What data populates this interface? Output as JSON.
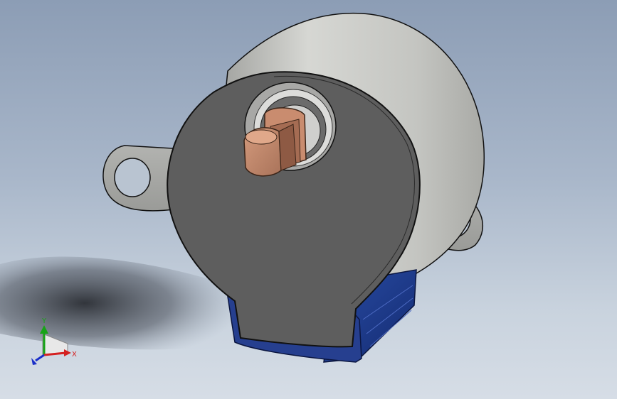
{
  "triad": {
    "x_label": "X",
    "y_label": "Y",
    "x_color": "#d42020",
    "y_color": "#17a317",
    "z_color": "#1b2fc8"
  },
  "colors": {
    "background_top": "#8c9db5",
    "background_bottom": "#d6dde6",
    "housing": "#5f5f5f",
    "housing_side": "#c8c9c6",
    "shaft": "#b88367",
    "connector": "#1f3c8f"
  }
}
